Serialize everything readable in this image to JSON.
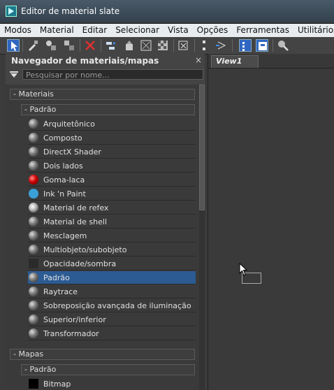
{
  "window": {
    "title": "Editor de material slate"
  },
  "menu": [
    "Modos",
    "Material",
    "Editar",
    "Selecionar",
    "Vista",
    "Opções",
    "Ferramentas",
    "Utilitários"
  ],
  "toolbar": {
    "icons": [
      "select-arrow-icon",
      "eyedropper-icon",
      "assign-material-icon",
      "put-material-icon",
      "delete-icon",
      "move-children-icon",
      "layout-icon",
      "hide-unused-icon",
      "checker-background-icon",
      "show-map-icon",
      "layout-all-icon",
      "children-icon",
      "navigator-icon",
      "parameter-editor-icon",
      "find-material-icon"
    ],
    "active": [
      "select-arrow-icon",
      "navigator-icon",
      "parameter-editor-icon"
    ]
  },
  "browser": {
    "title": "Navegador de materiais/mapas",
    "close": "×",
    "search_placeholder": "Pesquisar por nome...",
    "group_materials": "- Materiais",
    "subgroup_default": "- Padrão",
    "materials": [
      {
        "label": "Arquitetônico",
        "icon": "gray"
      },
      {
        "label": "Composto",
        "icon": "gray"
      },
      {
        "label": "DirectX Shader",
        "icon": "gray"
      },
      {
        "label": "Dois lados",
        "icon": "gray"
      },
      {
        "label": "Goma-laca",
        "icon": "red"
      },
      {
        "label": "Ink 'n Paint",
        "icon": "blue"
      },
      {
        "label": "Material de refex",
        "icon": "refl"
      },
      {
        "label": "Material de shell",
        "icon": "gray"
      },
      {
        "label": "Mesclagem",
        "icon": "gray"
      },
      {
        "label": "Multiobjeto/subobjeto",
        "icon": "gray"
      },
      {
        "label": "Opacidade/sombra",
        "icon": "dark"
      },
      {
        "label": "Padrão",
        "icon": "gray",
        "selected": true
      },
      {
        "label": "Raytrace",
        "icon": "gray"
      },
      {
        "label": "Sobreposição avançada de iluminação",
        "icon": "gray"
      },
      {
        "label": "Superior/inferior",
        "icon": "gray"
      },
      {
        "label": "Transformador",
        "icon": "gray"
      }
    ],
    "group_maps": "- Mapas",
    "subgroup_maps_default": "- Padrão",
    "maps": [
      {
        "label": "Bitmap",
        "icon": "black"
      }
    ]
  },
  "view": {
    "tab_label": "View1"
  },
  "colors": {
    "accent": "#2c5b94",
    "panel": "#444444",
    "background": "#3b3b3b"
  }
}
